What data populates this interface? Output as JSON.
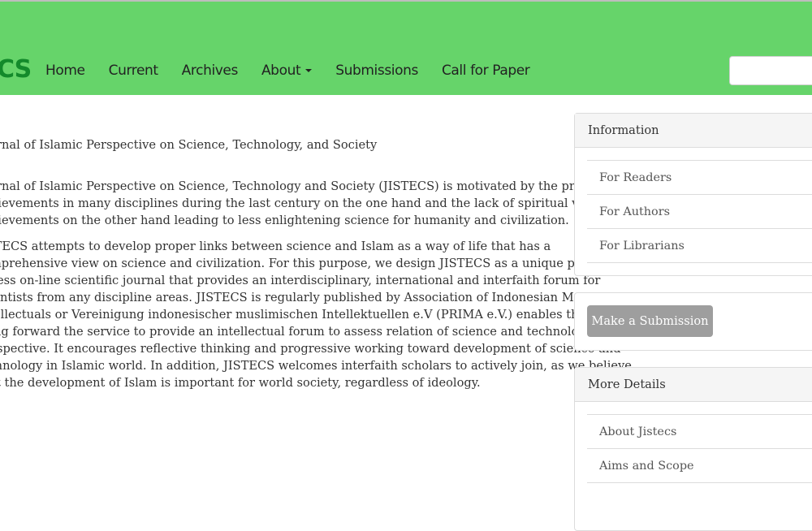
{
  "colors": {
    "brand": "#66d46a",
    "logo": "#138a2b"
  },
  "header": {
    "logo_text": "CS",
    "nav": [
      {
        "label": "Home"
      },
      {
        "label": "Current"
      },
      {
        "label": "Archives"
      },
      {
        "label": "About"
      },
      {
        "label": "Submissions"
      },
      {
        "label": "Call for Paper"
      }
    ],
    "search_value": ""
  },
  "main": {
    "title": "Journal of Islamic Perspective on Science, Technology, and Society",
    "para1": [
      "Journal of Islamic Perspective on Science, Technology and Society (JISTECS) is motivated by the progressive",
      "achievements in many disciplines during the last century on the one hand and the lack of spiritual values in such",
      "achievements on the other hand leading to less enlightening science for humanity and civilization."
    ],
    "para2": [
      "JISTECS attempts to develop proper links between science and Islam as a way of life that has a",
      "comprehensive view on science and civilization. For this purpose, we design JISTECS as a unique peer-reviewed open",
      "access on-line scientific journal that provides an interdisciplinary, international and interfaith forum for",
      "scientists from any discipline areas. JISTECS is regularly published by Association of Indonesian Moslem",
      "Intellectuals or Vereinigung indonesischer muslimischen Intellektuellen e.V (PRIMA e.V.) enables the PRIMA to",
      "bring forward the service to provide an intellectual forum to assess relation of science and technology with Islamic",
      "perspective. It encourages reflective thinking and progressive working toward development of science and",
      "technology in Islamic world. In addition, JISTECS welcomes interfaith scholars to actively join, as we believe",
      "that the development of Islam is important for world society, regardless of ideology."
    ]
  },
  "sidebar": {
    "information": {
      "title": "Information",
      "items": [
        "For Readers",
        "For Authors",
        "For Librarians"
      ]
    },
    "submission": {
      "button": "Make a Submission"
    },
    "more_details": {
      "title": "More Details",
      "items": [
        "About Jistecs",
        "Aims and Scope"
      ]
    }
  }
}
